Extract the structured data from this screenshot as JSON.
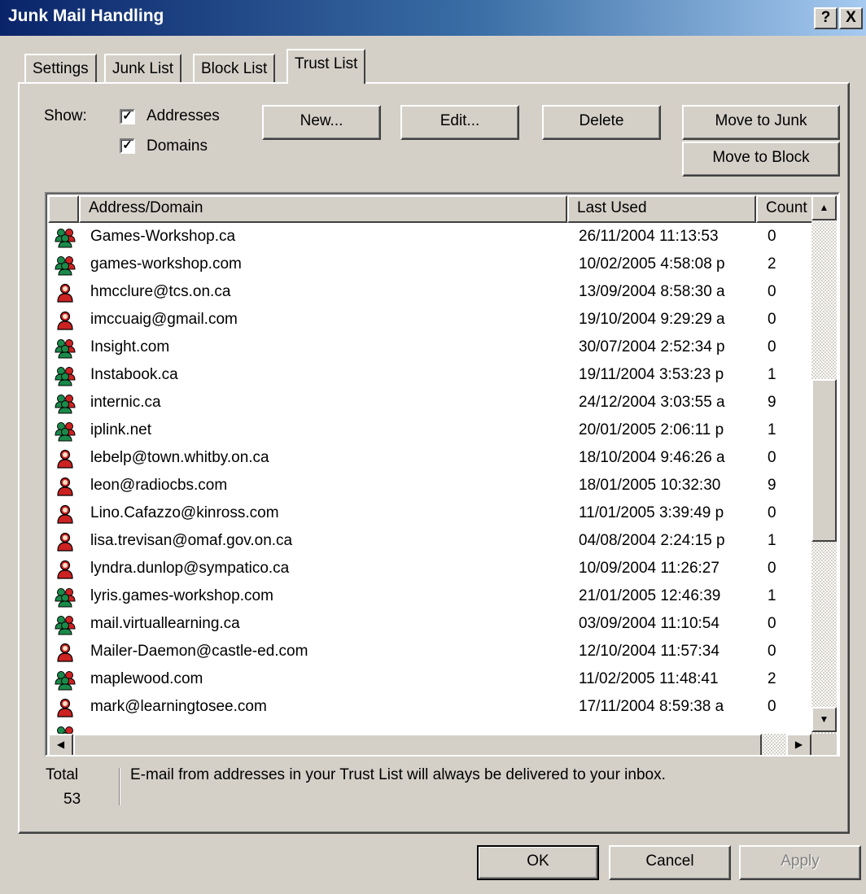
{
  "window": {
    "title": "Junk Mail Handling",
    "help_btn": "?",
    "close_btn": "X"
  },
  "tabs": [
    {
      "label": "Settings",
      "active": false
    },
    {
      "label": "Junk List",
      "active": false
    },
    {
      "label": "Block List",
      "active": false
    },
    {
      "label": "Trust List",
      "active": true
    }
  ],
  "filters": {
    "show_label": "Show:",
    "addresses_label": "Addresses",
    "addresses_checked": true,
    "domains_label": "Domains",
    "domains_checked": true
  },
  "toolbar": {
    "new_label": "New...",
    "edit_label": "Edit...",
    "delete_label": "Delete",
    "move_junk_label": "Move to Junk",
    "move_block_label": "Move to Block"
  },
  "list": {
    "columns": {
      "address": "Address/Domain",
      "last_used": "Last Used",
      "count": "Count"
    },
    "rows": [
      {
        "type": "domain",
        "address": "Games-Workshop.ca",
        "last_used": "26/11/2004 11:13:53",
        "count": "0"
      },
      {
        "type": "domain",
        "address": "games-workshop.com",
        "last_used": "10/02/2005 4:58:08 p",
        "count": "2"
      },
      {
        "type": "address",
        "address": "hmcclure@tcs.on.ca",
        "last_used": "13/09/2004 8:58:30 a",
        "count": "0"
      },
      {
        "type": "address",
        "address": "imccuaig@gmail.com",
        "last_used": "19/10/2004 9:29:29 a",
        "count": "0"
      },
      {
        "type": "domain",
        "address": "Insight.com",
        "last_used": "30/07/2004 2:52:34 p",
        "count": "0"
      },
      {
        "type": "domain",
        "address": "Instabook.ca",
        "last_used": "19/11/2004 3:53:23 p",
        "count": "1"
      },
      {
        "type": "domain",
        "address": "internic.ca",
        "last_used": "24/12/2004 3:03:55 a",
        "count": "9"
      },
      {
        "type": "domain",
        "address": "iplink.net",
        "last_used": "20/01/2005 2:06:11 p",
        "count": "1"
      },
      {
        "type": "address",
        "address": "lebelp@town.whitby.on.ca",
        "last_used": "18/10/2004 9:46:26 a",
        "count": "0"
      },
      {
        "type": "address",
        "address": "leon@radiocbs.com",
        "last_used": "18/01/2005 10:32:30",
        "count": "9"
      },
      {
        "type": "address",
        "address": "Lino.Cafazzo@kinross.com",
        "last_used": "11/01/2005 3:39:49 p",
        "count": "0"
      },
      {
        "type": "address",
        "address": "lisa.trevisan@omaf.gov.on.ca",
        "last_used": "04/08/2004 2:24:15 p",
        "count": "1"
      },
      {
        "type": "address",
        "address": "lyndra.dunlop@sympatico.ca",
        "last_used": "10/09/2004 11:26:27",
        "count": "0"
      },
      {
        "type": "domain",
        "address": "lyris.games-workshop.com",
        "last_used": "21/01/2005 12:46:39",
        "count": "1"
      },
      {
        "type": "domain",
        "address": "mail.virtuallearning.ca",
        "last_used": "03/09/2004 11:10:54",
        "count": "0"
      },
      {
        "type": "address",
        "address": "Mailer-Daemon@castle-ed.com",
        "last_used": "12/10/2004 11:57:34",
        "count": "0"
      },
      {
        "type": "domain",
        "address": "maplewood.com",
        "last_used": "11/02/2005 11:48:41",
        "count": "2"
      },
      {
        "type": "address",
        "address": "mark@learningtosee.com",
        "last_used": "17/11/2004 8:59:38 a",
        "count": "0"
      },
      {
        "type": "domain",
        "address": "",
        "last_used": "",
        "count": ""
      }
    ]
  },
  "footer": {
    "total_label": "Total",
    "total_value": "53",
    "info_text": "E-mail from addresses in your Trust List will always be delivered to your inbox."
  },
  "buttons": {
    "ok_label": "OK",
    "cancel_label": "Cancel",
    "apply_label": "Apply"
  },
  "colors": {
    "address_icon": "#cc2222",
    "domain_icon_a": "#1a8a4a",
    "domain_icon_b": "#cc2222"
  }
}
